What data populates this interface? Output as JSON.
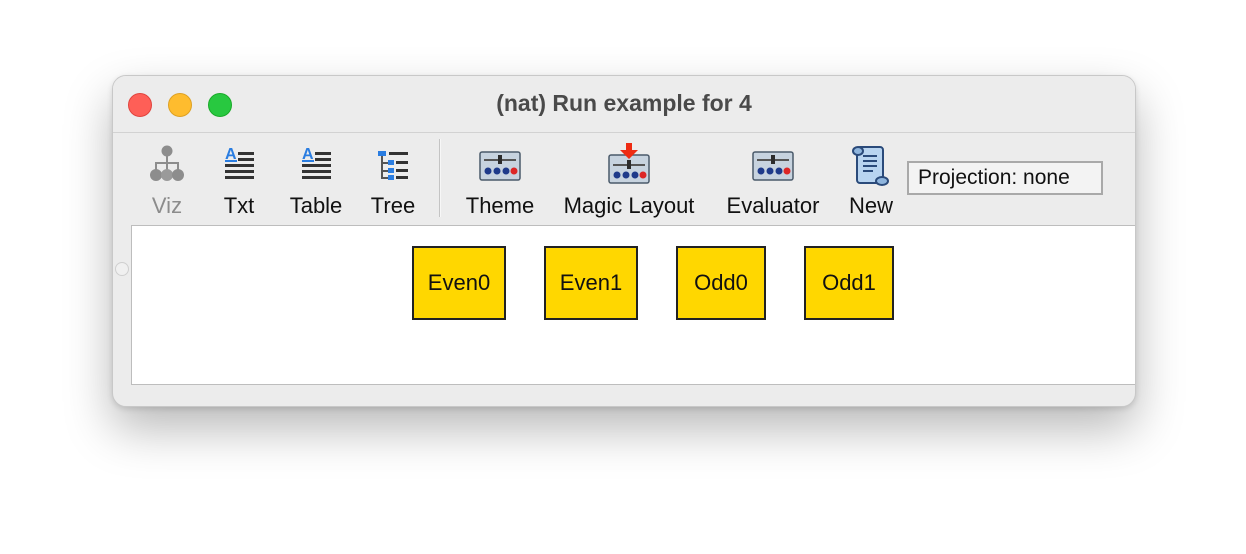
{
  "window": {
    "title": "(nat) Run example for 4"
  },
  "toolbar": {
    "tools": [
      {
        "label": "Viz",
        "icon": "graph-tree-icon",
        "enabled": false
      },
      {
        "label": "Txt",
        "icon": "text-lines-icon",
        "enabled": true
      },
      {
        "label": "Table",
        "icon": "table-lines-icon",
        "enabled": true
      },
      {
        "label": "Tree",
        "icon": "tree-list-icon",
        "enabled": true
      },
      {
        "label": "Theme",
        "icon": "sliders-panel-icon",
        "enabled": true
      },
      {
        "label": "Magic Layout",
        "icon": "sliders-panel-arrow-icon",
        "enabled": true
      },
      {
        "label": "Evaluator",
        "icon": "sliders-panel-icon",
        "enabled": true
      },
      {
        "label": "New",
        "icon": "scroll-document-icon",
        "enabled": true
      }
    ],
    "projection": "Projection: none"
  },
  "canvas": {
    "nodes": [
      "Even0",
      "Even1",
      "Odd0",
      "Odd1"
    ],
    "node_color": "#ffd700"
  },
  "colors": {
    "close": "#fe5f57",
    "minimize": "#febc2e",
    "maximize": "#28c840"
  }
}
